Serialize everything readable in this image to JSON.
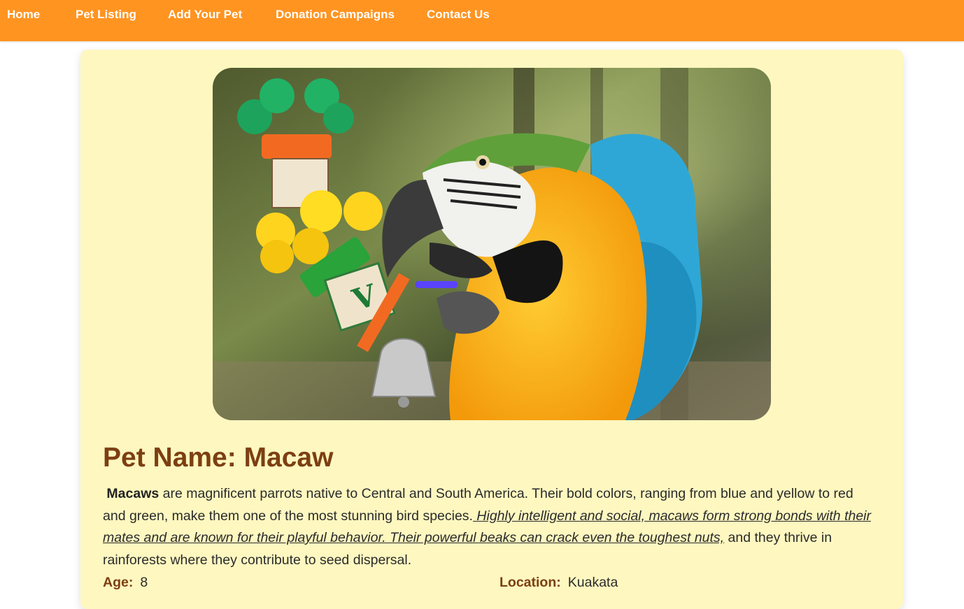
{
  "nav": {
    "items": [
      {
        "label": "Home"
      },
      {
        "label": "Pet Listing"
      },
      {
        "label": "Add Your Pet"
      },
      {
        "label": "Donation Campaigns"
      },
      {
        "label": "Contact Us"
      }
    ]
  },
  "pet": {
    "image_alt": "Macaw",
    "title": "Pet Name: Macaw",
    "description": {
      "bold_lead": "Macaws",
      "plain_text": " are magnificent parrots native to Central and South America. Their bold colors, ranging from blue and yellow to red and green, make them one of the most stunning bird species.",
      "emphasis_text": " Highly intelligent and social, macaws form strong bonds with their mates and are known for their playful behavior. Their powerful beaks can crack even the toughest nuts,",
      "trailing_text": " and they thrive in rainforests where they contribute to seed dispersal."
    },
    "age_label": "Age:",
    "age_value": "8",
    "location_label": "Location:",
    "location_value": "Kuakata"
  },
  "colors": {
    "navbar": "#ff9421",
    "card": "#fef7c0",
    "title": "#7c3f12"
  }
}
